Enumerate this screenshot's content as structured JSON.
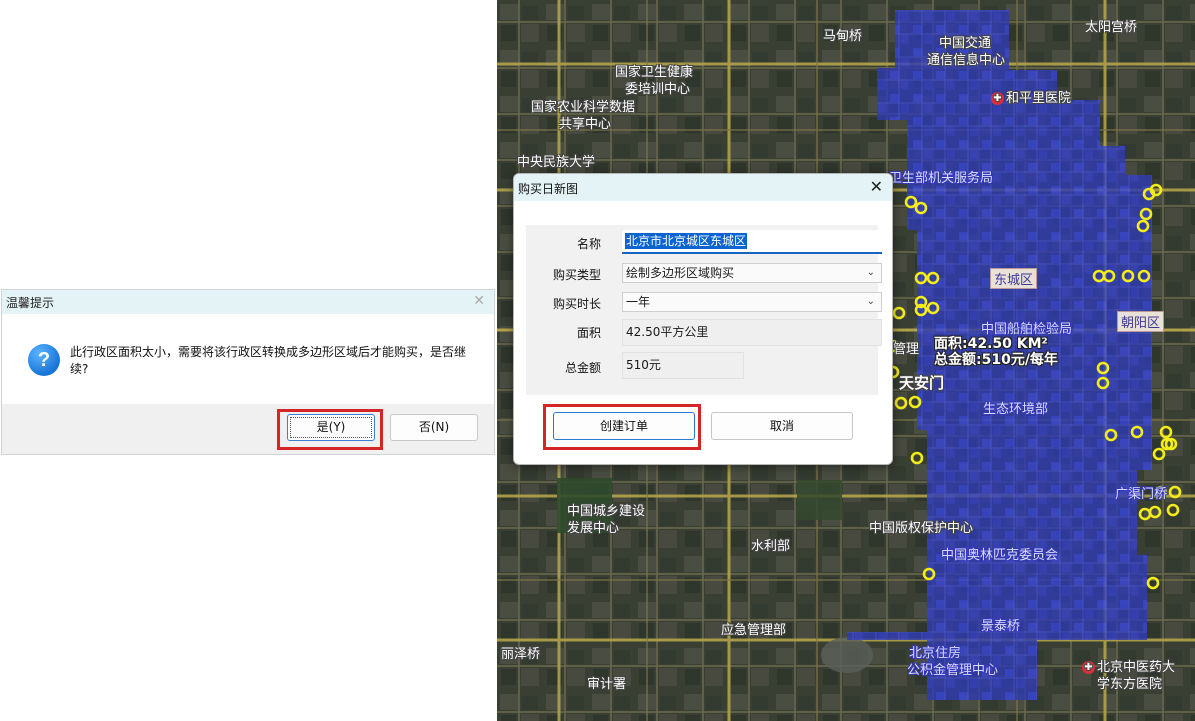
{
  "msgbox": {
    "title": "温馨提示",
    "close": "✕",
    "icon": "?",
    "message": "此行政区面积太小，需要将该行政区转换成多边形区域后才能购买，是否继续?",
    "yes_label": "是(Y)",
    "no_label": "否(N)"
  },
  "dialog": {
    "title": "购买日新图",
    "close": "✕",
    "name_label": "名称",
    "name_value": "北京市北京城区东城区",
    "type_label": "购买类型",
    "type_value": "绘制多边形区域购买",
    "duration_label": "购买时长",
    "duration_value": "一年",
    "area_label": "面积",
    "area_value": "42.50平方公里",
    "total_label": "总金额",
    "total_value": "510元",
    "create_label": "创建订单",
    "cancel_label": "取消"
  },
  "map": {
    "area_line": "面积:42.50 KM²",
    "price_line": "总金额:510元/每年",
    "labels": {
      "l1": "国家卫生健康",
      "l2": "委培训中心",
      "l3": "国家农业科学数据",
      "l4": "共享中心",
      "l5": "中央民族大学",
      "l6": "马甸桥",
      "l7": "中国交通",
      "l8": "通信信息中心",
      "l9": "太阳宫桥",
      "l10": "和平里医院",
      "l11": "卫生部机关服务局",
      "l12": "中国船舶检验局",
      "l13": "天安门",
      "l14": "生态环境部",
      "l15": "中国城乡建设",
      "l16": "发展中心",
      "l17": "水利部",
      "l18": "中国版权保护中心",
      "l19": "中国奥林匹克委员会",
      "l20": "应急管理部",
      "l21": "丽泽桥",
      "l22": "审计署",
      "l23": "景泰桥",
      "l24": "北京住房",
      "l25": "公积金管理中心",
      "l26": "北京中医药大",
      "l27": "学东方医院",
      "l28": "广渠门桥",
      "l29": "管理",
      "d1": "东城区",
      "d2": "朝阳区"
    }
  },
  "colors": {
    "overlay": "#3c3cf0",
    "highlight": "#d42626",
    "marker": "#f2ec1a",
    "title_bg": "#e4f3f5",
    "accent": "#1565c0"
  }
}
